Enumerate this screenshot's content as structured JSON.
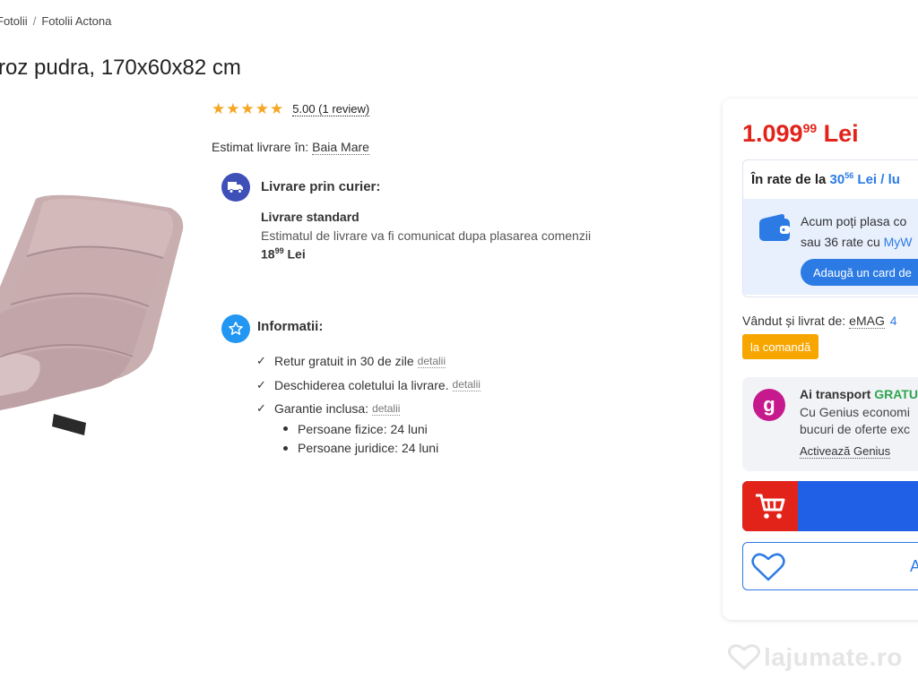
{
  "breadcrumb": {
    "items": [
      "Fotolii",
      "Fotolii Actona"
    ],
    "separator": "/"
  },
  "product": {
    "title": "roz pudra, 170x60x82 cm",
    "image_icon": "lounge-chair-image"
  },
  "rating": {
    "stars": 5,
    "link_text": "5.00 (1 review)",
    "star_color": "#f5a623"
  },
  "delivery": {
    "estimate_label": "Estimat livrare în:",
    "location": "Baia Mare",
    "courier_heading": "Livrare prin curier:",
    "courier_icon": "delivery-truck-icon",
    "standard_title": "Livrare standard",
    "standard_desc": "Estimatul de livrare va fi comunicat dupa plasarea comenzii",
    "price_int": "18",
    "price_dec": "99",
    "price_currency": "Lei"
  },
  "info": {
    "heading": "Informatii:",
    "icon": "star-badge-icon",
    "items": [
      {
        "text": "Retur gratuit in 30 de zile",
        "details": "detalii"
      },
      {
        "text": "Deschiderea coletului la livrare.",
        "details": "detalii"
      },
      {
        "text": "Garantie inclusa:",
        "details": "detalii"
      }
    ],
    "warranty": [
      "Persoane fizice: 24 luni",
      "Persoane juridice: 24 luni"
    ]
  },
  "buybox": {
    "price_int": "1.099",
    "price_dec": "99",
    "price_currency": "Lei",
    "installments": {
      "prefix": "În rate de la",
      "amount_int": "30",
      "amount_dec": "56",
      "suffix": "Lei / lu",
      "line1": "Acum poți plasa co",
      "line2_prefix": "sau 36 rate cu",
      "line2_link": "MyW",
      "button": "Adaugă un card de"
    },
    "seller_label": "Vândut și livrat de:",
    "seller_name": "eMAG",
    "seller_rating": "4",
    "badge": "la comandă",
    "genius": {
      "logo": "g",
      "title_prefix": "Ai transport",
      "title_highlight": "GRATU",
      "line1": "Cu Genius economi",
      "line2": "bucuri de oferte exc",
      "link": "Activează Genius"
    },
    "cart_icon": "shopping-cart-icon",
    "favorite_icon": "heart-icon",
    "favorite_label": "A"
  },
  "colors": {
    "price_red": "#e2231a",
    "link_blue": "#2c7be5",
    "badge_orange": "#f7a600",
    "genius_magenta": "#c6198d",
    "cart_blue": "#1f60e6"
  },
  "watermark": "lajumate.ro"
}
